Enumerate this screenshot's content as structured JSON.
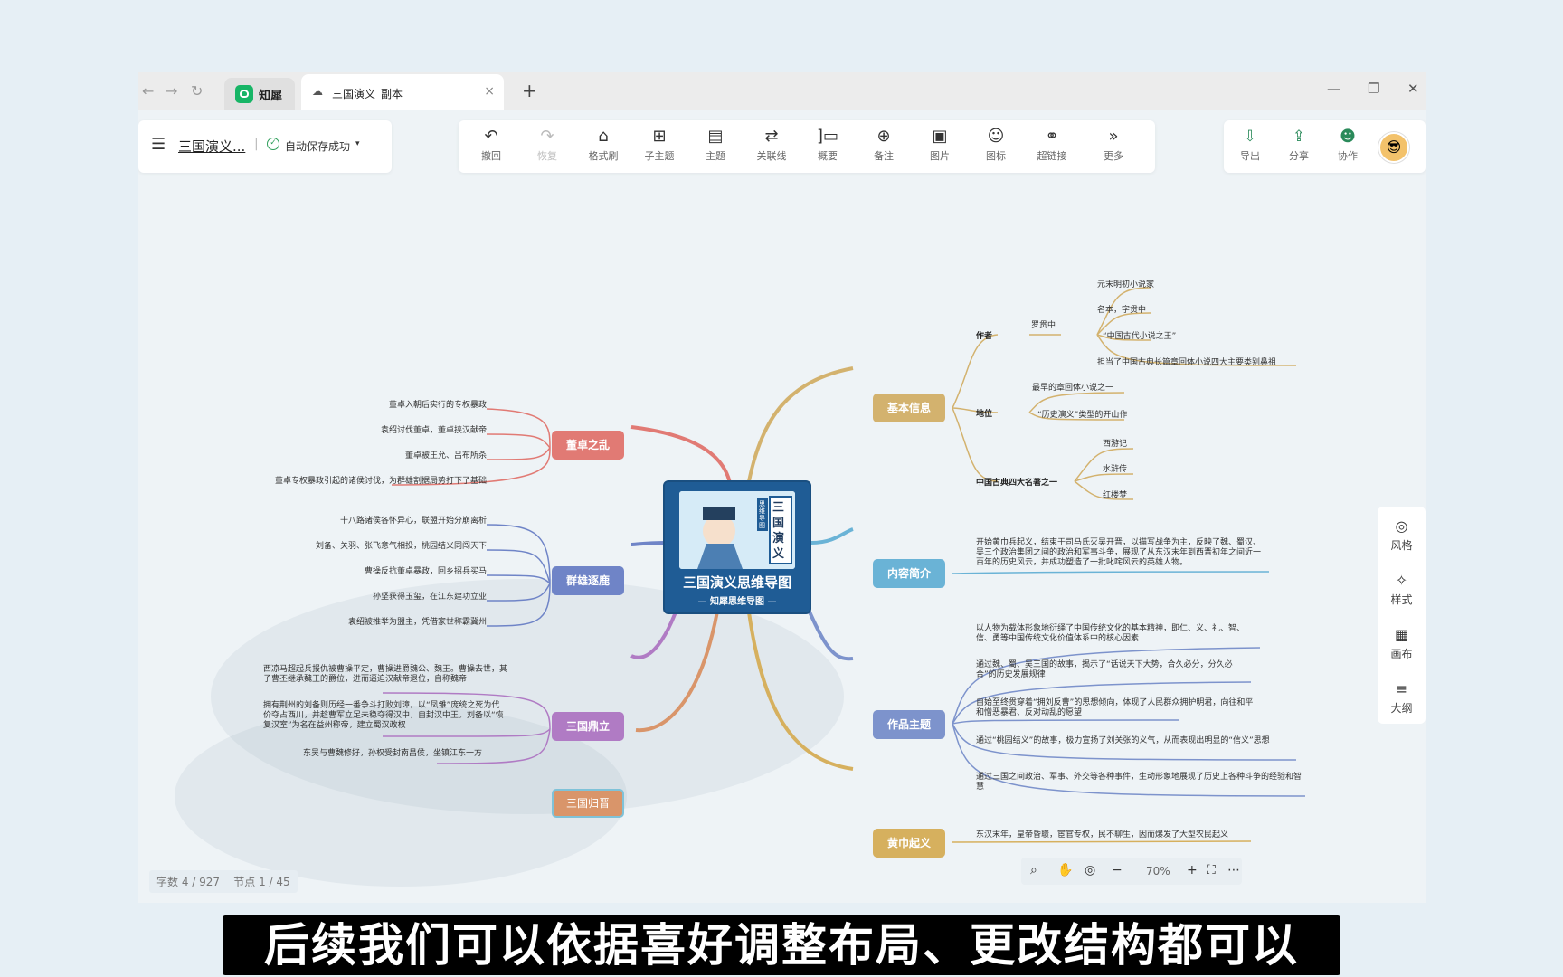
{
  "tabs": {
    "app_label": "知犀",
    "doc_label": "三国演义_副本",
    "close": "×",
    "new": "+"
  },
  "window_controls": {
    "minimize": "—",
    "restore": "❐",
    "close": "✕"
  },
  "doc": {
    "title": "三国演义...",
    "separator": "|",
    "save_status": "自动保存成功",
    "save_caret": "▾",
    "save_check": "✓"
  },
  "toolbar": [
    {
      "icon": "↶",
      "label": "撤回"
    },
    {
      "icon": "↷",
      "label": "恢复"
    },
    {
      "icon": "⌂",
      "label": "格式刷"
    },
    {
      "icon": "⊞",
      "label": "子主题"
    },
    {
      "icon": "▤",
      "label": "主题"
    },
    {
      "icon": "⇄",
      "label": "关联线"
    },
    {
      "icon": "]▭",
      "label": "概要"
    },
    {
      "icon": "⊕",
      "label": "备注"
    },
    {
      "icon": "▣",
      "label": "图片"
    },
    {
      "icon": "☺",
      "label": "图标"
    },
    {
      "icon": "⚭",
      "label": "超链接"
    },
    {
      "icon": "»",
      "label": "更多"
    }
  ],
  "right_tools": [
    {
      "icon": "⇩",
      "label": "导出"
    },
    {
      "icon": "⇪",
      "label": "分享"
    },
    {
      "icon": "☻",
      "label": "协作"
    }
  ],
  "side_panel": [
    {
      "icon": "◎",
      "label": "风格"
    },
    {
      "icon": "✧",
      "label": "样式"
    },
    {
      "icon": "▦",
      "label": "画布"
    },
    {
      "icon": "≡",
      "label": "大纲"
    }
  ],
  "central": {
    "title": "三国演义思维导图",
    "subtitle": "— 知犀思维导图 —",
    "cover_big": "三国演义",
    "cover_small": "思维导图"
  },
  "left_branches": [
    {
      "label": "董卓之乱",
      "color": "#e17a74",
      "items": [
        "董卓入朝后实行的专权暴政",
        "袁绍讨伐董卓，董卓挟汉献帝",
        "董卓被王允、吕布所杀",
        "董卓专权暴政引起的诸侯讨伐，为群雄割据局势打下了基础"
      ]
    },
    {
      "label": "群雄逐鹿",
      "color": "#6f84c7",
      "items": [
        "十八路诸侯各怀异心，联盟开始分崩离析",
        "刘备、关羽、张飞意气相投，桃园结义同闯天下",
        "曹操反抗董卓暴政，回乡招兵买马",
        "孙坚获得玉玺，在江东建功立业",
        "袁绍被推举为盟主，凭借家世称霸冀州"
      ]
    },
    {
      "label": "三国鼎立",
      "color": "#b07bc4",
      "items": [
        "西凉马超起兵报仇被曹操平定，曹操进爵魏公、魏王。曹操去世，其子曹丕继承魏王的爵位，进而逼迫汉献帝退位，自称魏帝",
        "拥有荆州的刘备则历经一番争斗打败刘璋，以“凤雏”庞统之死为代价夺占西川，并趁曹军立足未稳夺得汉中，自封汉中王。刘备以“恢复汉室”为名在益州称帝，建立蜀汉政权",
        "东吴与曹魏修好，孙权受封南昌侯，坐镇江东一方"
      ]
    },
    {
      "label": "三国归晋",
      "color": "#d9956a",
      "items": []
    }
  ],
  "right_branches": [
    {
      "label": "基本信息",
      "color": "#d3b26e"
    },
    {
      "label": "内容简介",
      "color": "#6ab3d6"
    },
    {
      "label": "作品主题",
      "color": "#7d93cc"
    },
    {
      "label": "黄巾起义",
      "color": "#d6b05e"
    }
  ],
  "basic_info": {
    "author_label": "作者",
    "author_name": "罗贯中",
    "author_items": [
      "元末明初小说家",
      "名本，字贯中",
      "“中国古代小说之王”",
      "担当了中国古典长篇章回体小说四大主要类别鼻祖"
    ],
    "status_label": "地位",
    "status_items": [
      "最早的章回体小说之一",
      "“历史演义”类型的开山作"
    ],
    "classics_label": "中国古典四大名著之一",
    "classics_items": [
      "西游记",
      "水浒传",
      "红楼梦"
    ]
  },
  "intro": "开始黄巾兵起义，结束于司马氏灭吴开晋，以描写战争为主，反映了魏、蜀汉、吴三个政治集团之间的政治和军事斗争，展现了从东汉末年到西晋初年之间近一百年的历史风云，并成功塑造了一批叱咤风云的英雄人物。",
  "themes": [
    "以人物为载体形象地衍绎了中国传统文化的基本精神，即仁、义、礼、智、信、勇等中国传统文化价值体系中的核心因素",
    "通过魏、蜀、吴三国的故事，揭示了“话说天下大势，合久必分，分久必合”的历史发展规律",
    "自始至终贯穿着“拥刘反曹”的思想倾向，体现了人民群众拥护明君，向往和平和憎恶暴君、反对动乱的愿望",
    "通过“桃园结义”的故事，极力宣扬了刘关张的义气，从而表现出明显的“信义”思想",
    "通过三国之间政治、军事、外交等各种事件，生动形象地展现了历史上各种斗争的经验和智慧"
  ],
  "yellow_turban": "东汉末年，皇帝昏聩，宦官专权，民不聊生，因而爆发了大型农民起义",
  "status_bar": {
    "words": "字数 4 / 927",
    "nodes": "节点 1 / 45"
  },
  "zoom": {
    "search": "⌕",
    "hand": "✋",
    "locate": "◎",
    "minus": "−",
    "level": "70%",
    "plus": "+",
    "fit": "⛶",
    "more": "⋯"
  },
  "caption": "后续我们可以依据喜好调整布局、更改结构都可以",
  "nav": {
    "back": "←",
    "forward": "→",
    "reload": "↻"
  },
  "menu_icon": "☰",
  "cloud_icon": "☁",
  "avatar": "😎"
}
